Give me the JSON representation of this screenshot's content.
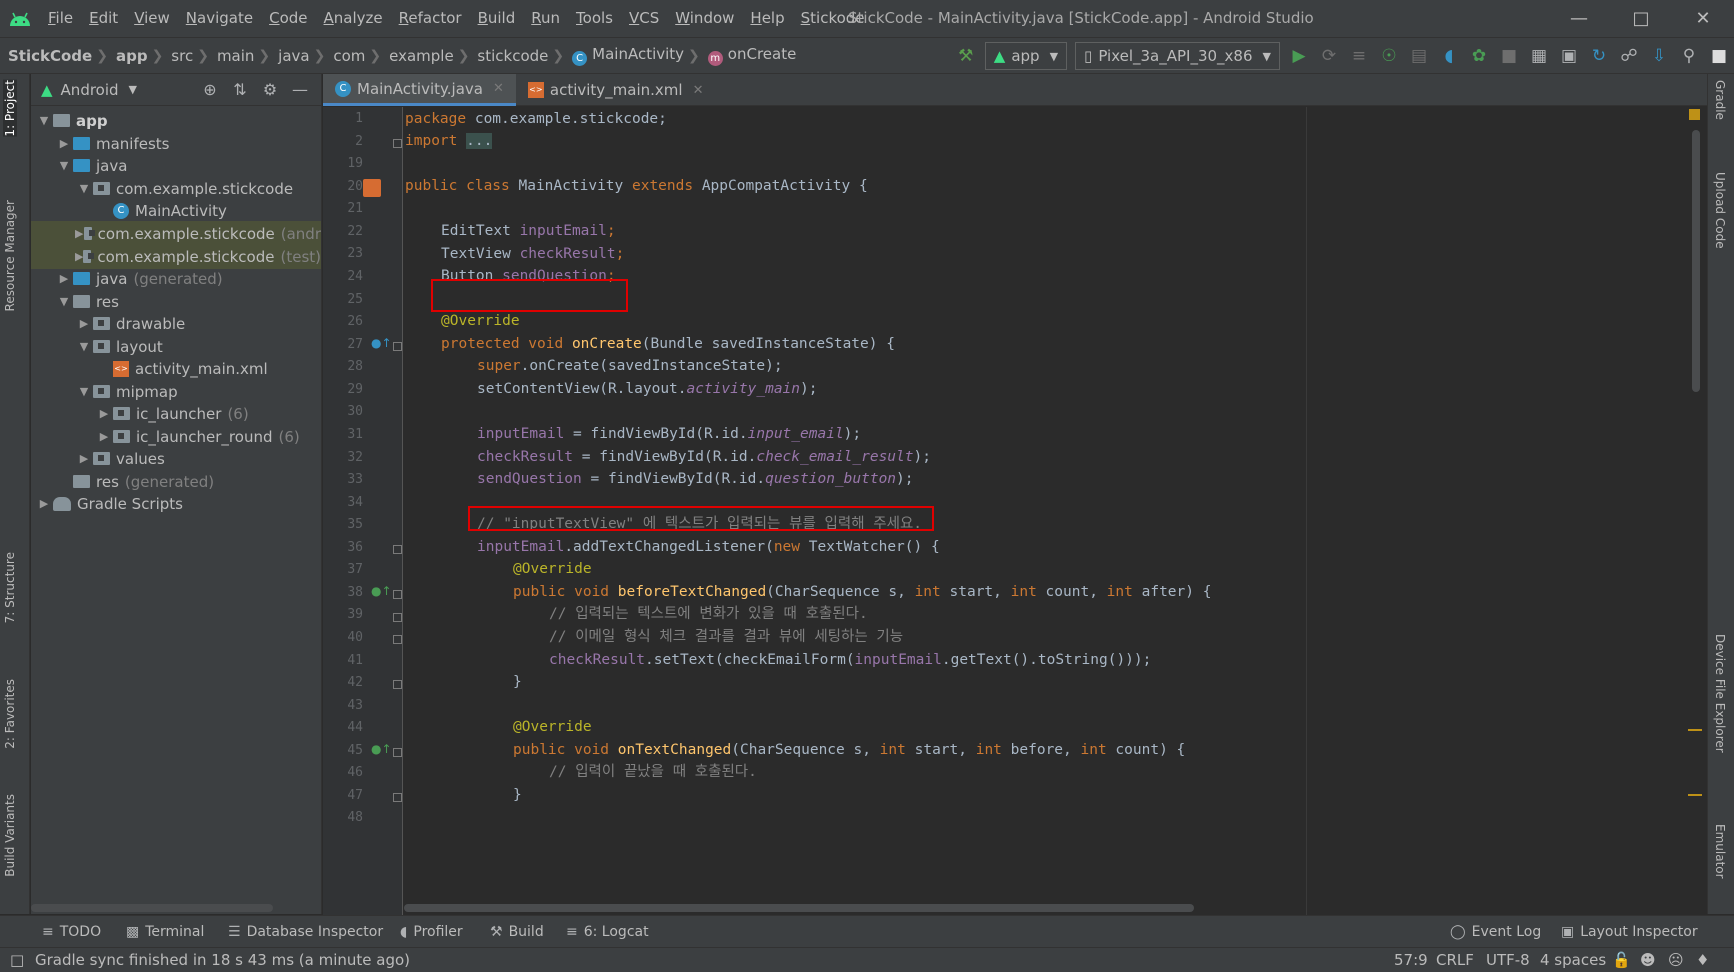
{
  "menubar": {
    "items": [
      "File",
      "Edit",
      "View",
      "Navigate",
      "Code",
      "Analyze",
      "Refactor",
      "Build",
      "Run",
      "Tools",
      "VCS",
      "Window",
      "Help",
      "Stickode"
    ],
    "window_title": "StickCode - MainActivity.java [StickCode.app] - Android Studio"
  },
  "breadcrumb": {
    "items": [
      "StickCode",
      "app",
      "src",
      "main",
      "java",
      "com",
      "example",
      "stickcode",
      "MainActivity",
      "onCreate"
    ]
  },
  "toolbar": {
    "run_config": "app",
    "device": "Pixel_3a_API_30_x86"
  },
  "left_strip": {
    "tabs": [
      "1: Project",
      "Resource Manager",
      "7: Structure",
      "2: Favorites",
      "Build Variants"
    ]
  },
  "right_strip": {
    "tabs": [
      "Gradle",
      "Upload Code",
      "Device File Explorer",
      "Emulator"
    ]
  },
  "project": {
    "view": "Android",
    "tree": [
      {
        "label": "app",
        "extra": ""
      },
      {
        "label": "manifests",
        "extra": ""
      },
      {
        "label": "java",
        "extra": ""
      },
      {
        "label": "com.example.stickcode",
        "extra": ""
      },
      {
        "label": "MainActivity",
        "extra": ""
      },
      {
        "label": "com.example.stickcode",
        "extra": "(andr"
      },
      {
        "label": "com.example.stickcode",
        "extra": "(test)"
      },
      {
        "label": "java",
        "extra": "(generated)"
      },
      {
        "label": "res",
        "extra": ""
      },
      {
        "label": "drawable",
        "extra": ""
      },
      {
        "label": "layout",
        "extra": ""
      },
      {
        "label": "activity_main.xml",
        "extra": ""
      },
      {
        "label": "mipmap",
        "extra": ""
      },
      {
        "label": "ic_launcher",
        "extra": "(6)"
      },
      {
        "label": "ic_launcher_round",
        "extra": "(6)"
      },
      {
        "label": "values",
        "extra": ""
      },
      {
        "label": "res",
        "extra": "(generated)"
      },
      {
        "label": "Gradle Scripts",
        "extra": ""
      }
    ]
  },
  "editor": {
    "tabs": [
      {
        "label": "MainActivity.java",
        "active": true
      },
      {
        "label": "activity_main.xml",
        "active": false
      }
    ],
    "line_numbers": [
      "1",
      "2",
      "19",
      "20",
      "21",
      "22",
      "23",
      "24",
      "25",
      "26",
      "27",
      "28",
      "29",
      "30",
      "31",
      "32",
      "33",
      "34",
      "35",
      "36",
      "37",
      "38",
      "39",
      "40",
      "41",
      "42",
      "43",
      "44",
      "45",
      "46",
      "47",
      "48"
    ],
    "code": {
      "l1_kw": "package",
      "l1_rest": " com.example.stickcode;",
      "l2_kw": "import",
      "l2_fold": "...",
      "l20_kw": "public class",
      "l20_name": " MainActivity ",
      "l20_kw2": "extends",
      "l20_rest": " AppCompatActivity {",
      "l22_type": "EditText ",
      "l22_field": "inputEmail",
      "l22_end": ";",
      "l23_type": "TextView ",
      "l23_field": "checkResult",
      "l23_end": ";",
      "l24_type": "Button ",
      "l24_field": "sendQuestion",
      "l24_end": ";",
      "l26_ann": "@Override",
      "l27_kw": "protected void",
      "l27_fn": "onCreate",
      "l27_rest": "(Bundle savedInstanceState) {",
      "l28_kw": "super",
      "l28_rest": ".onCreate(savedInstanceState);",
      "l29_a": "setContentView(R.layout.",
      "l29_it": "activity_main",
      "l29_b": ");",
      "l31_field": "inputEmail",
      "l31_a": " = findViewById(R.id.",
      "l31_it": "input_email",
      "l31_b": ");",
      "l32_field": "checkResult",
      "l32_a": " = findViewById(R.id.",
      "l32_it": "check_email_result",
      "l32_b": ");",
      "l33_field": "sendQuestion",
      "l33_a": " = findViewById(R.id.",
      "l33_it": "question_button",
      "l33_b": ");",
      "l35_cm": "// \"inputTextView\" 에 텍스트가 입력되는 뷰를 입력해 주세요.",
      "l36_field": "inputEmail",
      "l36_a": ".addTextChangedListener(",
      "l36_kw": "new",
      "l36_b": " TextWatcher() {",
      "l37_ann": "@Override",
      "l38_kw": "public void",
      "l38_fn": "beforeTextChanged",
      "l38_a": "(CharSequence s, ",
      "l38_kw2": "int",
      "l38_b": " start, ",
      "l38_kw3": "int",
      "l38_c": " count, ",
      "l38_kw4": "int",
      "l38_d": " after) {",
      "l39_cm": "// 입력되는 텍스트에 변화가 있을 때 호출된다.",
      "l40_cm": "// 이메일 형식 체크 결과를 결과 뷰에 세팅하는 기능",
      "l41_field": "checkResult",
      "l41_a": ".setText(checkEmailForm(",
      "l41_field2": "inputEmail",
      "l41_b": ".getText().toString()));",
      "l42": "}",
      "l44_ann": "@Override",
      "l45_kw": "public void",
      "l45_fn": "onTextChanged",
      "l45_a": "(CharSequence s, ",
      "l45_kw2": "int",
      "l45_b": " start, ",
      "l45_kw3": "int",
      "l45_c": " before, ",
      "l45_kw4": "int",
      "l45_d": " count) {",
      "l46_cm": "// 입력이 끝났을 때 호출된다.",
      "l47": "}"
    }
  },
  "bottom_tools": [
    "TODO",
    "Terminal",
    "Database Inspector",
    "Profiler",
    "Build",
    "6: Logcat",
    "Event Log",
    "Layout Inspector"
  ],
  "status": {
    "message": "Gradle sync finished in 18 s 43 ms (a minute ago)",
    "position": "57:9",
    "line_sep": "CRLF",
    "encoding": "UTF-8",
    "indent": "4 spaces"
  },
  "colors": {
    "highlight_box": "#e00000",
    "keyword": "#cc7832",
    "field": "#9876aa",
    "method": "#ffc66d",
    "annotation": "#bbb529",
    "comment": "#808080",
    "android_green": "#3ddc84"
  }
}
